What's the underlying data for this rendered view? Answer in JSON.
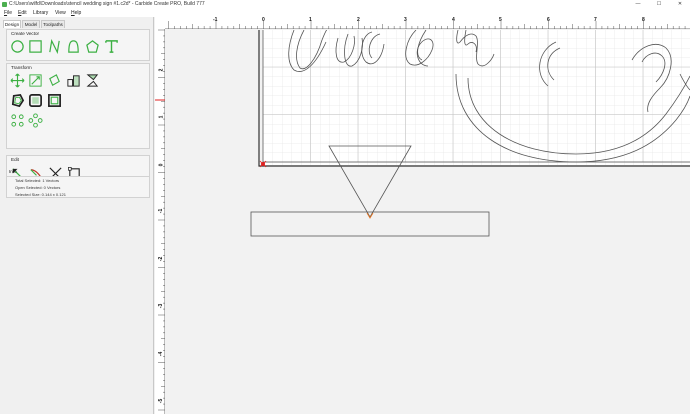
{
  "window": {
    "title": "C:\\Users\\wilfd\\Downloads\\stencil wedding sign #1.c2d* - Carbide Create PRO, Build 777",
    "minimize": "—",
    "maximize": "☐",
    "close": "✕"
  },
  "menu": {
    "file": "ile",
    "edit": "dit",
    "library": "Library",
    "view": "View",
    "help": "elp"
  },
  "tabs": [
    "Design",
    "Model",
    "Toolpaths"
  ],
  "sections": {
    "create_vector": "Create Vector",
    "transform": "Transform",
    "edit": "Edit",
    "info": "Info"
  },
  "info": {
    "total_selected": "Total Selected:  1 Vectors",
    "open_selected": "Open Selected:  0 Vectors",
    "selected_size": "Selected Size:    0.144 x 0.121"
  },
  "ruler": {
    "top": [
      "-1",
      "0",
      "1",
      "2",
      "3",
      "4",
      "5",
      "6",
      "7",
      "8"
    ],
    "left": [
      "2",
      "1",
      "0",
      "-1",
      "-2",
      "-3",
      "-4",
      "-5"
    ]
  },
  "colors": {
    "accent_green": "#3cb043",
    "origin_red": "#e02020",
    "node_orange": "#e87722",
    "grid_minor": "#dcdcdc",
    "grid_major": "#c4c4c4"
  },
  "icons": {
    "create_vector": [
      "circle-icon",
      "rectangle-icon",
      "polyline-icon",
      "curve-icon",
      "polygon-icon",
      "text-icon"
    ],
    "transform": [
      "move-icon",
      "scale-icon",
      "rotate-icon",
      "align-icon",
      "mirror-icon",
      "offset-icon",
      "boolean-icon",
      "fillet-icon",
      "circle-array-icon",
      "grid-array-icon"
    ],
    "edit": [
      "node-edit-icon",
      "trim-icon",
      "cut-icon",
      "bounding-box-icon"
    ]
  }
}
